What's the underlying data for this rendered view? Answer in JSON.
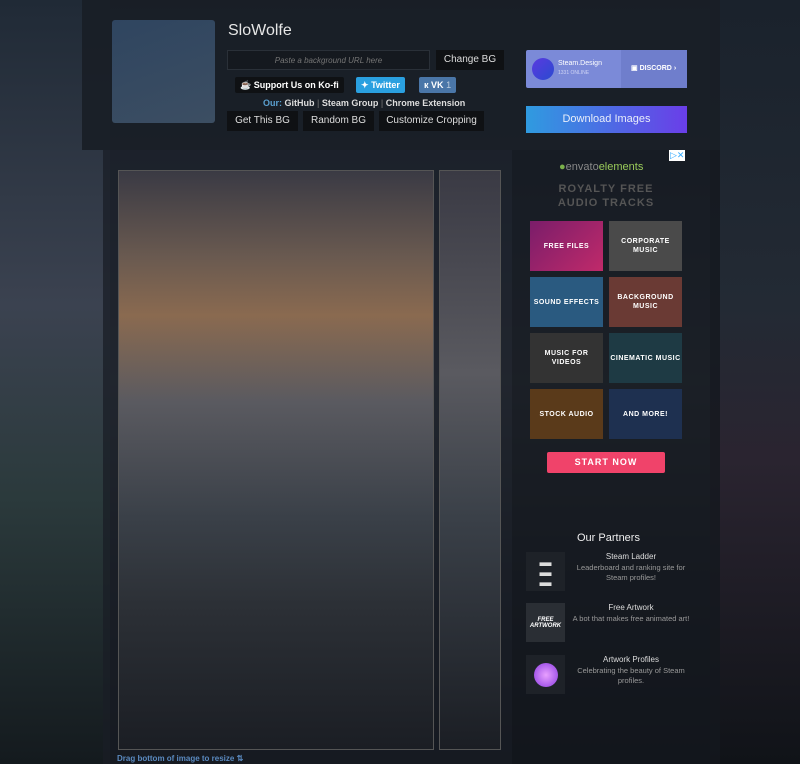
{
  "profile": {
    "name": "SloWolfe"
  },
  "toolbar": {
    "url_placeholder": "Paste a background URL here",
    "change_bg": "Change BG",
    "get_bg": "Get This BG",
    "random_bg": "Random BG",
    "customize": "Customize Cropping"
  },
  "social": {
    "kofi": "Support Us on Ko-fi",
    "twitter": "Twitter",
    "vk": "VK",
    "vk_count": "1"
  },
  "links": {
    "our": "Our:",
    "github": "GitHub",
    "steam_group": "Steam Group",
    "chrome": "Chrome Extension"
  },
  "drag_hint": "Drag bottom of image to resize",
  "discord": {
    "server": "Steam.Design",
    "online": "1331 ONLINE",
    "label": "DISCORD"
  },
  "download": "Download Images",
  "ad": {
    "brand_a": "envato",
    "brand_b": "elements",
    "headline1": "ROYALTY FREE",
    "headline2": "AUDIO TRACKS",
    "tiles": [
      "FREE FILES",
      "CORPORATE MUSIC",
      "SOUND EFFECTS",
      "BACKGROUND MUSIC",
      "MUSIC FOR VIDEOS",
      "CINEMATIC MUSIC",
      "STOCK AUDIO",
      "AND MORE!"
    ],
    "cta": "START NOW"
  },
  "partners": {
    "heading": "Our Partners",
    "items": [
      {
        "title": "Steam Ladder",
        "desc": "Leaderboard and ranking site for Steam profiles!"
      },
      {
        "title": "Free Artwork",
        "desc": "A bot that makes free animated art!",
        "icon_text": "FREE ARTWORK"
      },
      {
        "title": "Artwork Profiles",
        "desc": "Celebrating the beauty of Steam profiles."
      }
    ]
  },
  "colors": {
    "twitter": "#1da1f2",
    "vk": "#4a76a8",
    "cta": "#f0436a",
    "link": "#5aa0d0"
  }
}
